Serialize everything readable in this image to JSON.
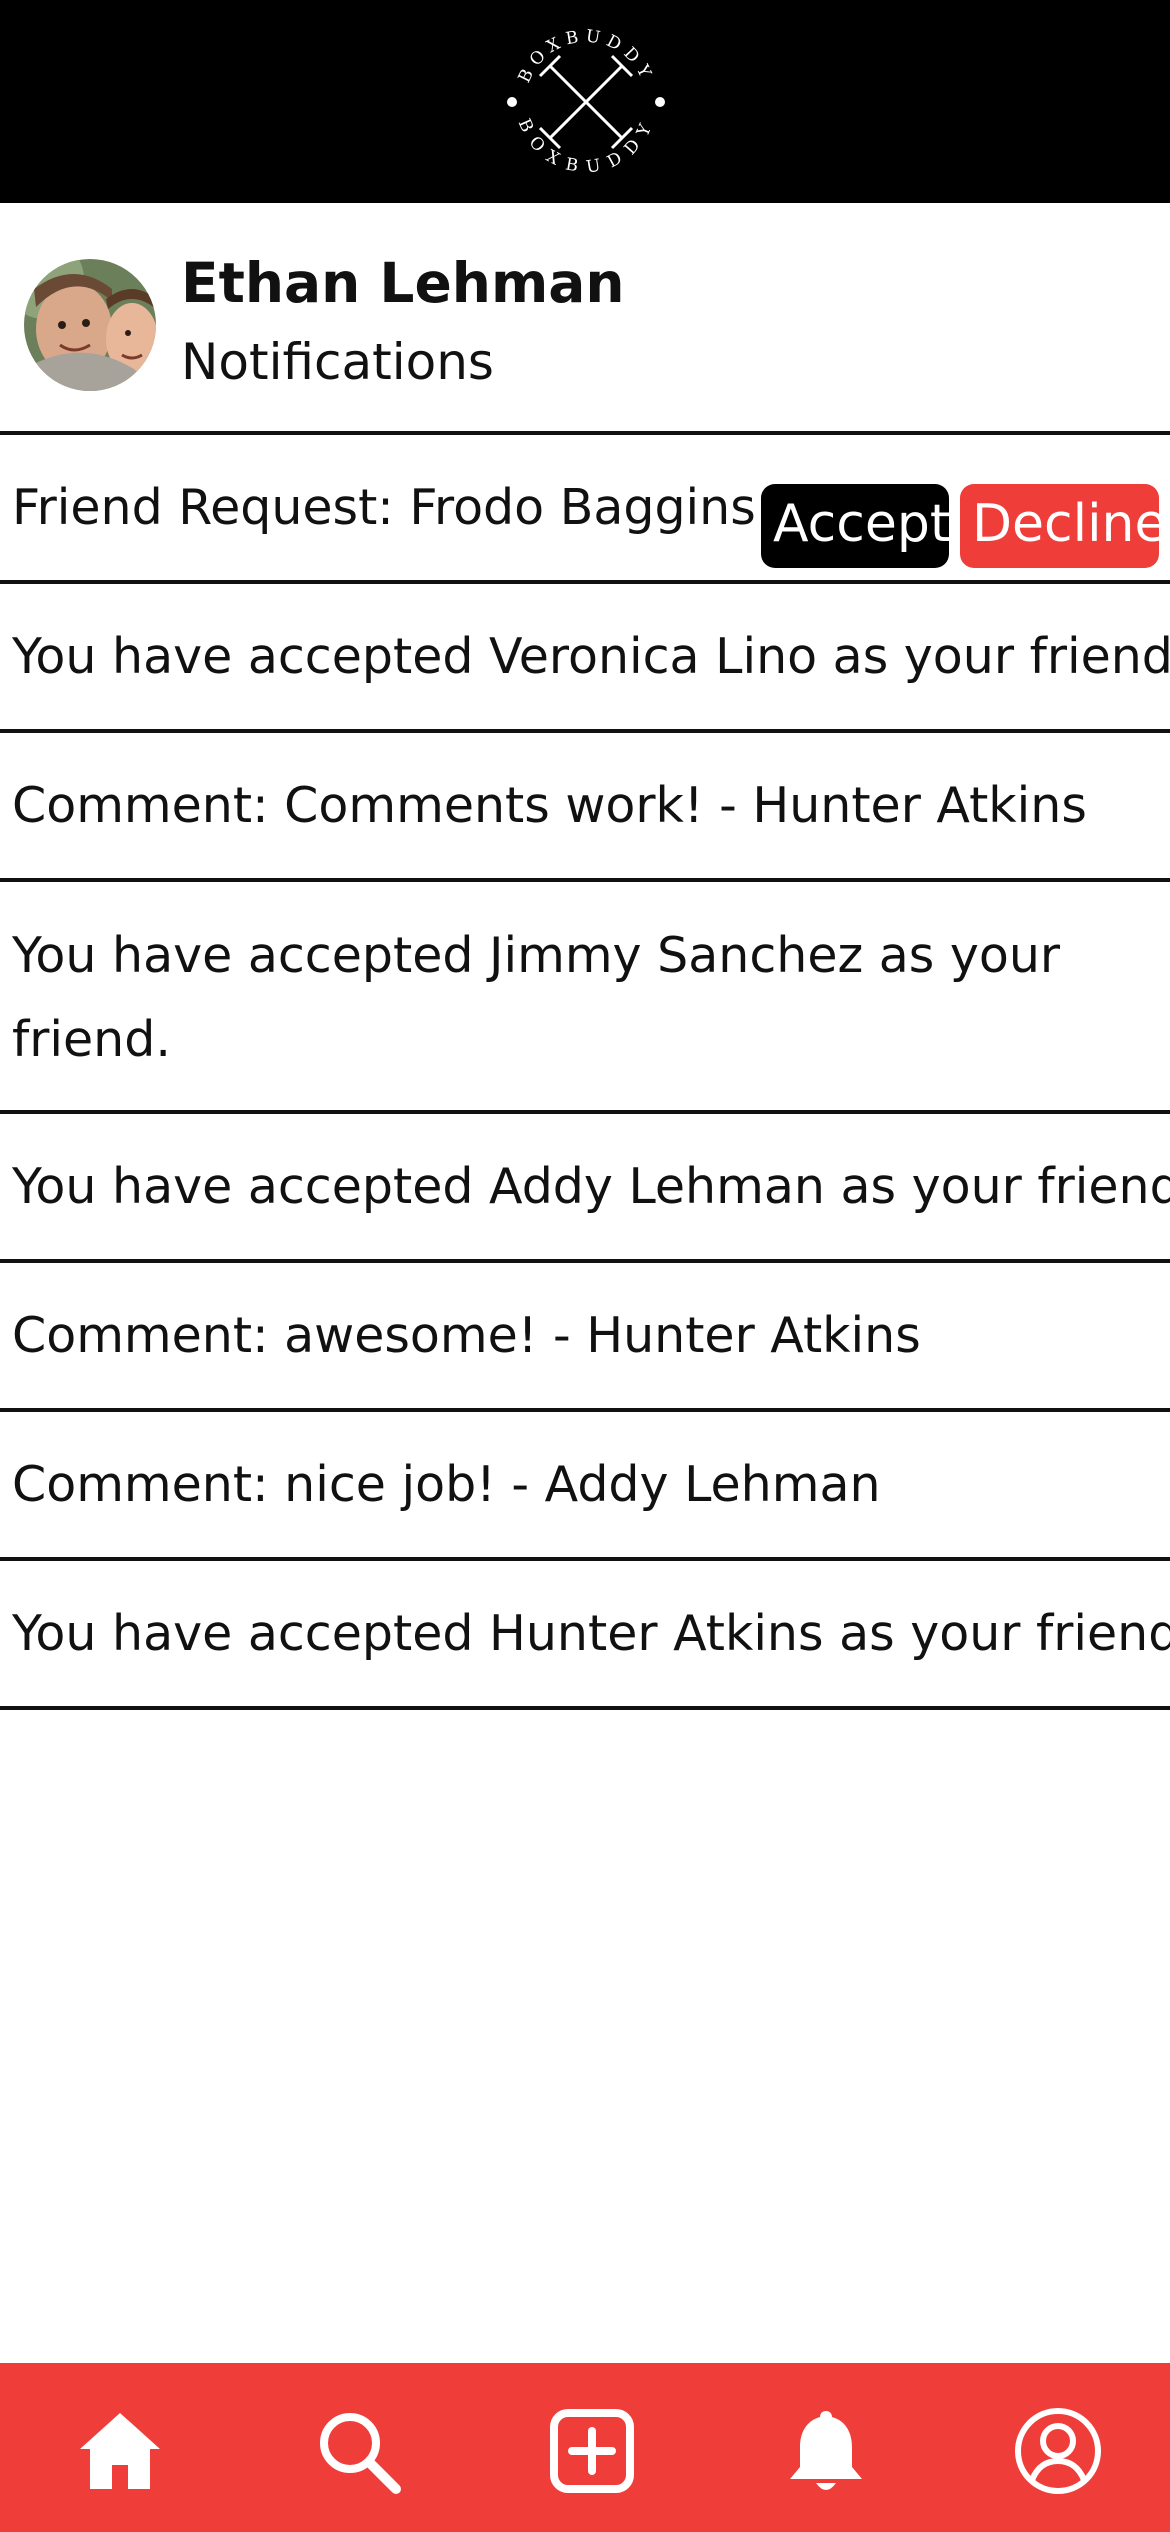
{
  "brand": {
    "logo_text": "BOXBUDDY",
    "accent_color": "#ef3e3a",
    "header_color": "#000000"
  },
  "profile": {
    "name": "Ethan Lehman",
    "page_title": "Notifications"
  },
  "friend_request": {
    "text": "Friend Request: Frodo Baggins",
    "accept_label": "Accept",
    "decline_label": "Decline"
  },
  "notifications": [
    "You have accepted Veronica Lino as your friend.",
    "Comment: Comments work! - Hunter Atkins",
    "You have accepted Jimmy Sanchez as your friend.",
    "You have accepted Addy Lehman as your friend.",
    "Comment: awesome! - Hunter Atkins",
    "Comment: nice job! - Addy Lehman",
    "You have accepted Hunter Atkins as your friend."
  ],
  "bottom_nav": {
    "items": [
      {
        "icon": "home-icon"
      },
      {
        "icon": "search-icon"
      },
      {
        "icon": "add-post-icon"
      },
      {
        "icon": "bell-icon"
      },
      {
        "icon": "profile-icon"
      }
    ]
  }
}
